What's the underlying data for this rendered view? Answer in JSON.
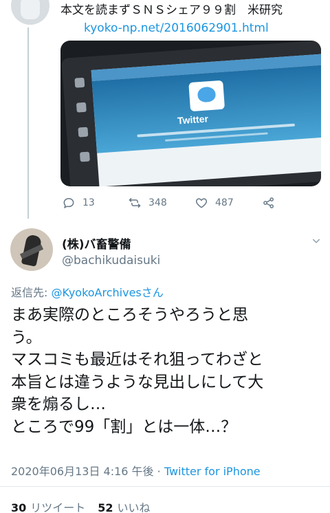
{
  "parent_tweet": {
    "text": "本文を読まずＳＮＳシェア９９割　米研究",
    "link": "kyoko-np.net/2016062901.html",
    "media": {
      "screen_title": "Twitter"
    },
    "actions": {
      "reply_count": "13",
      "retweet_count": "348",
      "like_count": "487"
    }
  },
  "main_tweet": {
    "display_name": "(株)バ畜警備",
    "screen_name": "@bachikudaisuki",
    "reply_to_label": "返信先: ",
    "reply_to_handle": "@KyokoArchivesさん",
    "body_lines": [
      "まあ実際のところそうやろうと思",
      "う。",
      "マスコミも最近はそれ狙ってわざと",
      "本旨とは違うような見出しにして大",
      "衆を煽るし…",
      "ところで99「割」とは一体…？"
    ],
    "timestamp": "2020年06月13日 4:16 午後 · ",
    "source": "Twitter for iPhone",
    "retweets_count": "30",
    "retweets_label": "リツイート",
    "likes_count": "52",
    "likes_label": "いいね"
  },
  "colors": {
    "link_blue": "#1b95e0",
    "secondary_text": "#657786",
    "primary_text": "#14171a"
  }
}
